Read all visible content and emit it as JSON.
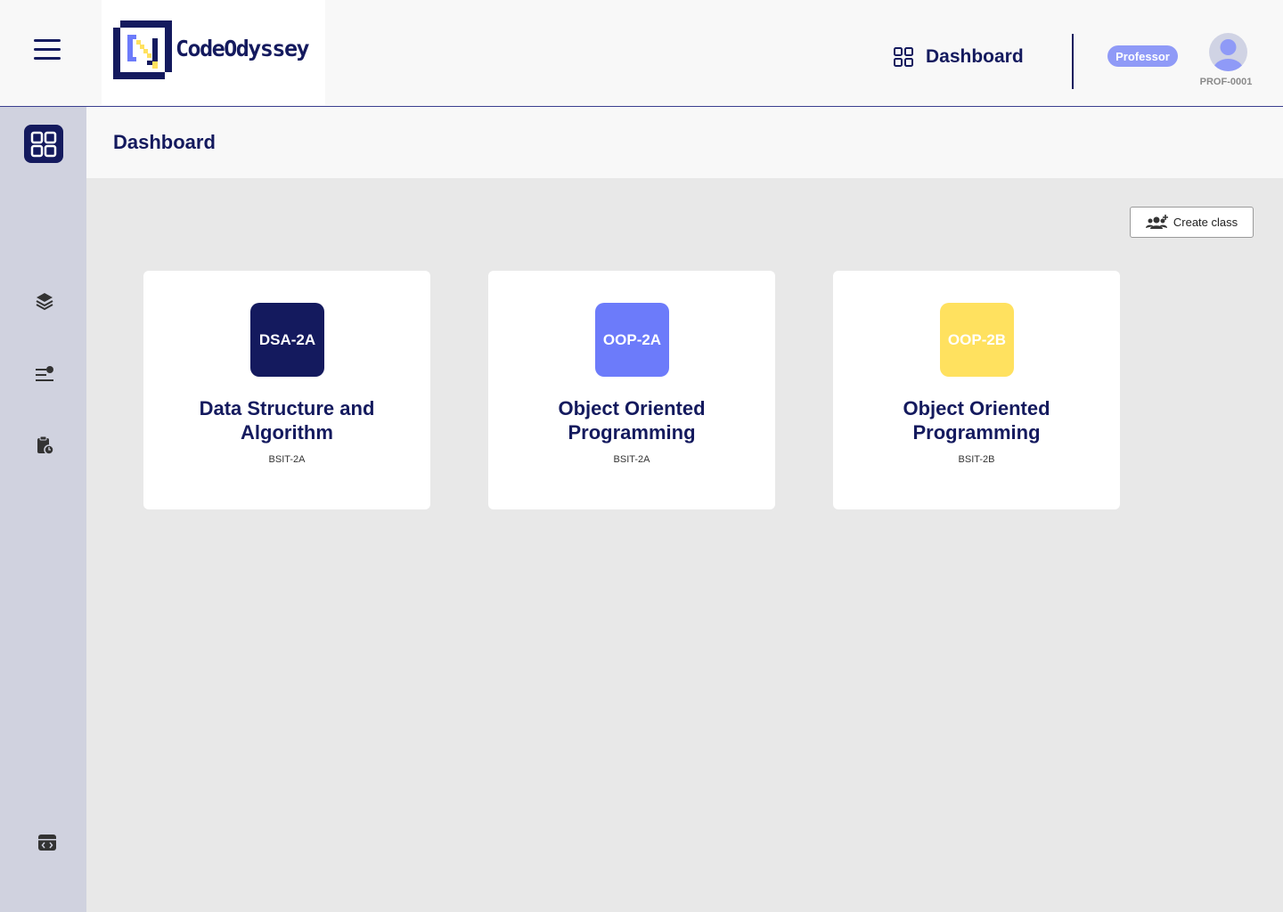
{
  "header": {
    "brand": "CodeOdyssey",
    "nav_label": "Dashboard",
    "role": "Professor",
    "user_id": "PROF-0001"
  },
  "sidebar": {
    "items": [
      {
        "icon": "grid-icon",
        "active": true
      },
      {
        "icon": "layers-icon",
        "active": false
      },
      {
        "icon": "list-icon",
        "active": false
      },
      {
        "icon": "clipboard-icon",
        "active": false
      },
      {
        "icon": "code-window-icon",
        "active": false
      }
    ]
  },
  "main": {
    "title": "Dashboard",
    "create_label": "Create class"
  },
  "classes": [
    {
      "code": "DSA-2A",
      "name": "Data Structure and Algorithm",
      "section": "BSIT-2A",
      "color": "#141a5e"
    },
    {
      "code": "OOP-2A",
      "name": "Object Oriented Programming",
      "section": "BSIT-2A",
      "color": "#6c7bfa"
    },
    {
      "code": "OOP-2B",
      "name": "Object Oriented Programming",
      "section": "BSIT-2B",
      "color": "#ffe15f"
    }
  ],
  "colors": {
    "primary": "#141a5e",
    "sidebar": "#d0d2df",
    "badge": "#8f9af7"
  }
}
